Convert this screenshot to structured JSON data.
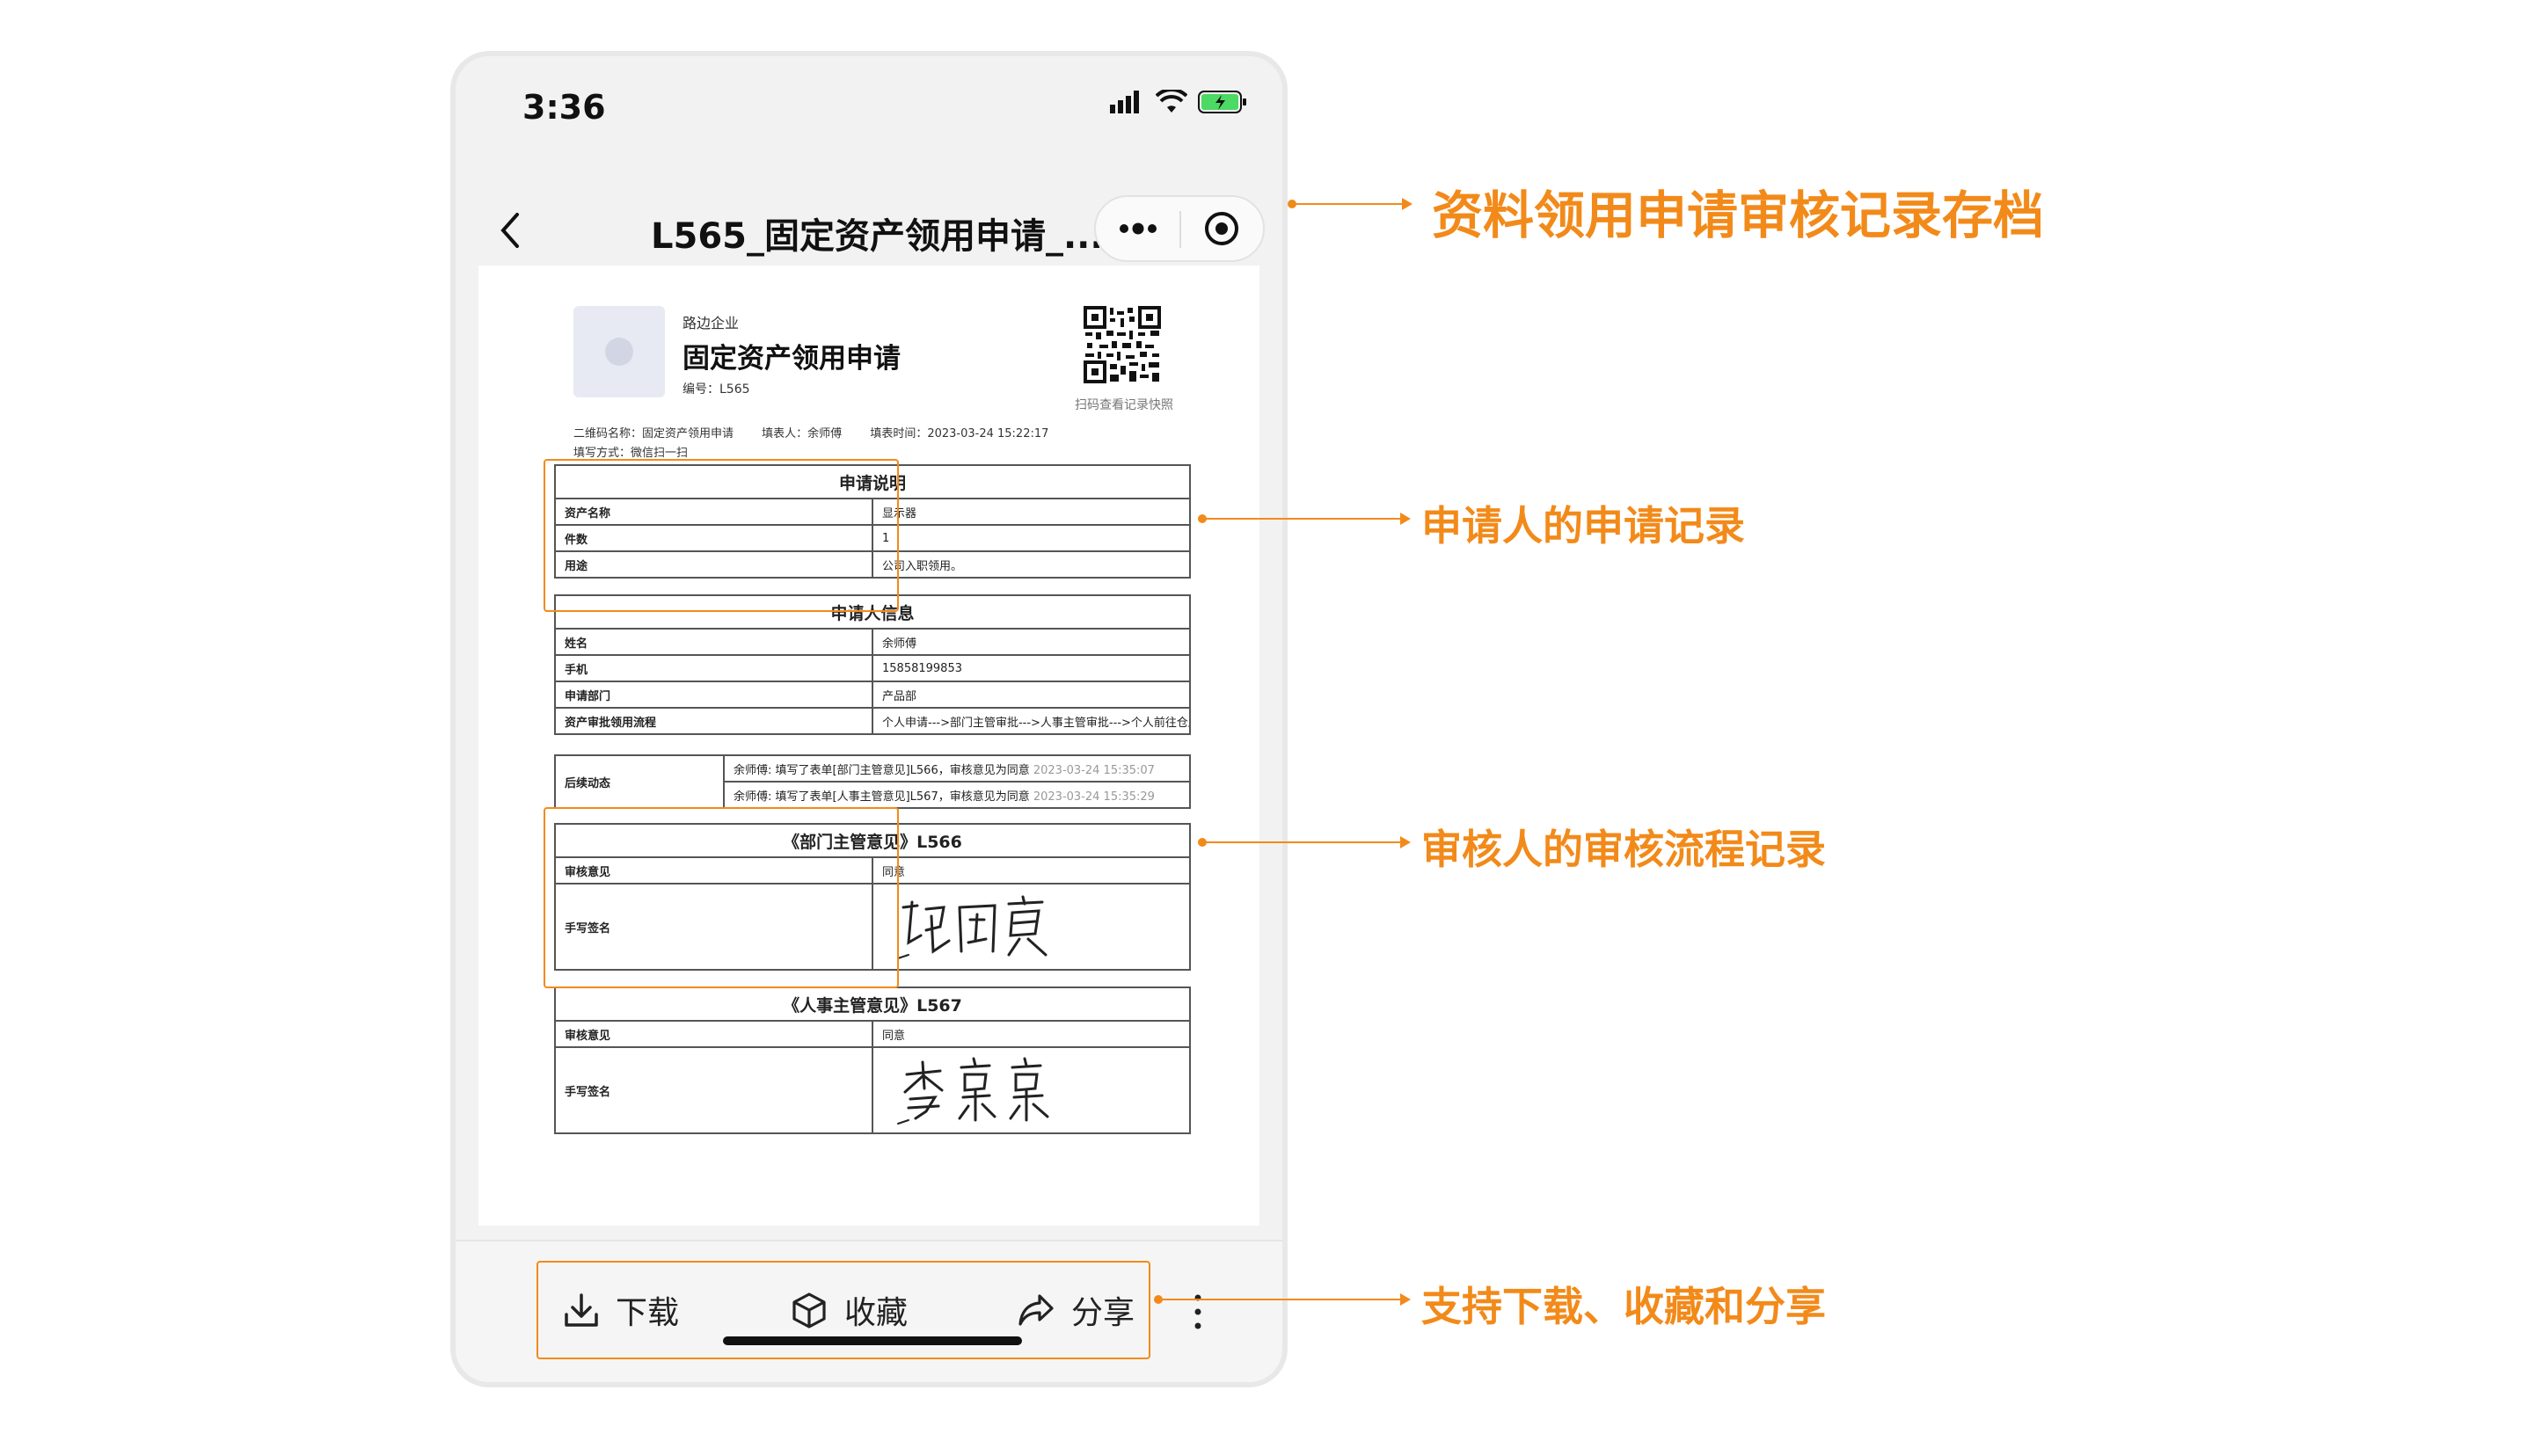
{
  "status_bar": {
    "time": "3:36"
  },
  "navbar": {
    "title": "L565_固定资产领用申请_..."
  },
  "document": {
    "company": "路边企业",
    "title": "固定资产领用申请",
    "number": "编号：L565",
    "qr_caption": "扫码查看记录快照",
    "meta_qr_name": "二维码名称：固定资产领用申请",
    "meta_filler": "填表人：余师傅",
    "meta_time": "填表时间：2023-03-24 15:22:17",
    "meta_method": "填写方式：微信扫一扫",
    "application": {
      "header": "申请说明",
      "rows": [
        {
          "key": "资产名称",
          "value": "显示器"
        },
        {
          "key": "件数",
          "value": "1"
        },
        {
          "key": "用途",
          "value": "公司入职领用。"
        }
      ]
    },
    "applicant": {
      "header": "申请人信息",
      "rows": [
        {
          "key": "姓名",
          "value": "余师傅"
        },
        {
          "key": "手机",
          "value": "15858199853"
        },
        {
          "key": "申请部门",
          "value": "产品部"
        },
        {
          "key": "资产审批领用流程",
          "value": "个人申请--->部门主管审批--->人事主管审批--->个人前往仓库领用"
        }
      ]
    },
    "follow_up": {
      "key": "后续动态",
      "entries": [
        {
          "text": "余师傅: 填写了表单[部门主管意见]L566，审核意见为同意",
          "time": "2023-03-24 15:35:07"
        },
        {
          "text": "余师傅: 填写了表单[人事主管意见]L567，审核意见为同意",
          "time": "2023-03-24 15:35:29"
        }
      ]
    },
    "review1": {
      "header": "《部门主管意见》L566",
      "opinion_key": "审核意见",
      "opinion_value": "同意",
      "sign_key": "手写签名"
    },
    "review2": {
      "header": "《人事主管意见》L567",
      "opinion_key": "审核意见",
      "opinion_value": "同意",
      "sign_key": "手写签名"
    }
  },
  "bottom_bar": {
    "download": "下载",
    "collect": "收藏",
    "share": "分享"
  },
  "annotations": {
    "archive": "资料领用申请审核记录存档",
    "applicant_record": "申请人的申请记录",
    "review_record": "审核人的审核流程记录",
    "actions": "支持下载、收藏和分享"
  },
  "colors": {
    "accent": "#f28a1a",
    "battery": "#4cd964"
  }
}
